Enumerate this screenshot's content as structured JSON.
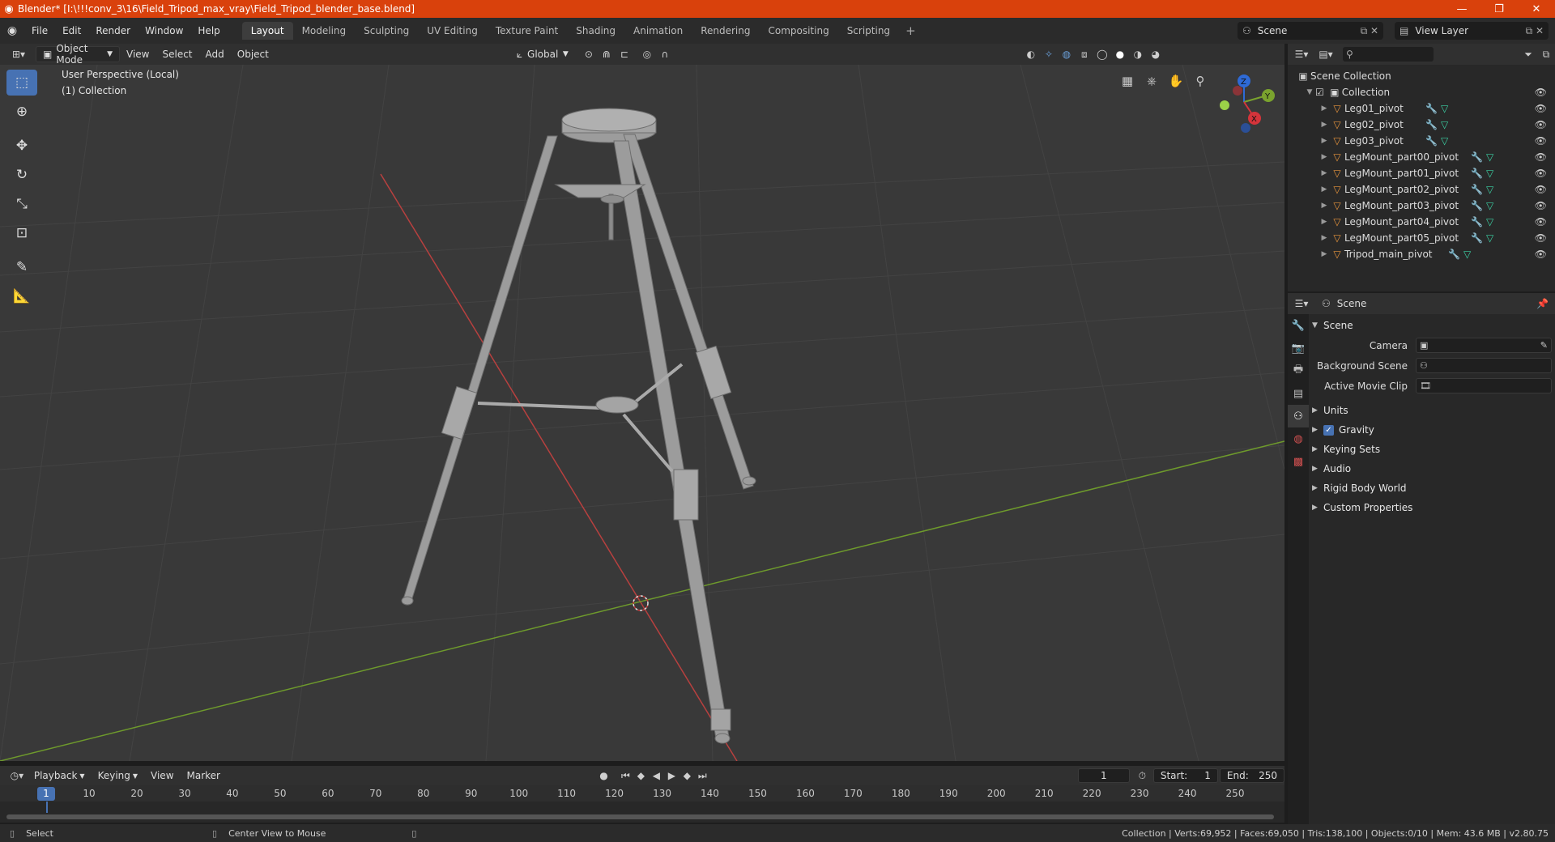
{
  "window": {
    "title": "Blender* [I:\\!!!conv_3\\16\\Field_Tripod_max_vray\\Field_Tripod_blender_base.blend]",
    "controls": {
      "minimize": "—",
      "maximize": "❐",
      "close": "✕"
    }
  },
  "menu": {
    "items": [
      "File",
      "Edit",
      "Render",
      "Window",
      "Help"
    ],
    "workspaces": [
      "Layout",
      "Modeling",
      "Sculpting",
      "UV Editing",
      "Texture Paint",
      "Shading",
      "Animation",
      "Rendering",
      "Compositing",
      "Scripting"
    ],
    "active_workspace": "Layout",
    "add_workspace": "+",
    "scene": "Scene",
    "view_layer": "View Layer"
  },
  "viewport_header": {
    "mode": "Object Mode",
    "menus": [
      "View",
      "Select",
      "Add",
      "Object"
    ],
    "orientation": "Global"
  },
  "viewport": {
    "perspective_label": "User Perspective (Local)",
    "collection_label": "(1) Collection",
    "gizmo": {
      "z": "Z",
      "y": "Y",
      "x": "X"
    },
    "colors": {
      "x_axis": "#b8403f",
      "y_axis": "#6e9a2c",
      "model": "#9a9a9a",
      "background": "#393939"
    }
  },
  "outliner": {
    "root": "Scene Collection",
    "collection": "Collection",
    "objects": [
      "Leg01_pivot",
      "Leg02_pivot",
      "Leg03_pivot",
      "LegMount_part00_pivot",
      "LegMount_part01_pivot",
      "LegMount_part02_pivot",
      "LegMount_part03_pivot",
      "LegMount_part04_pivot",
      "LegMount_part05_pivot",
      "Tripod_main_pivot"
    ]
  },
  "properties": {
    "context": "Scene",
    "section": "Scene",
    "fields": [
      {
        "label": "Camera",
        "value": ""
      },
      {
        "label": "Background Scene",
        "value": ""
      },
      {
        "label": "Active Movie Clip",
        "value": ""
      }
    ],
    "panels": [
      "Units",
      "Gravity",
      "Keying Sets",
      "Audio",
      "Rigid Body World",
      "Custom Properties"
    ],
    "gravity_checked": true
  },
  "timeline": {
    "menus": [
      "Playback",
      "Keying",
      "View",
      "Marker"
    ],
    "current_frame": "1",
    "start_label": "Start:",
    "start": "1",
    "end_label": "End:",
    "end": "250",
    "ticks": [
      "10",
      "20",
      "30",
      "40",
      "50",
      "60",
      "70",
      "80",
      "90",
      "100",
      "110",
      "120",
      "130",
      "140",
      "150",
      "160",
      "170",
      "180",
      "190",
      "200",
      "210",
      "220",
      "230",
      "240",
      "250"
    ],
    "current_indicator": "1"
  },
  "statusbar": {
    "select": "Select",
    "center_view": "Center View to Mouse",
    "stats": "Collection | Verts:69,952 | Faces:69,050 | Tris:138,100 | Objects:0/10 | Mem: 43.6 MB | v2.80.75"
  }
}
